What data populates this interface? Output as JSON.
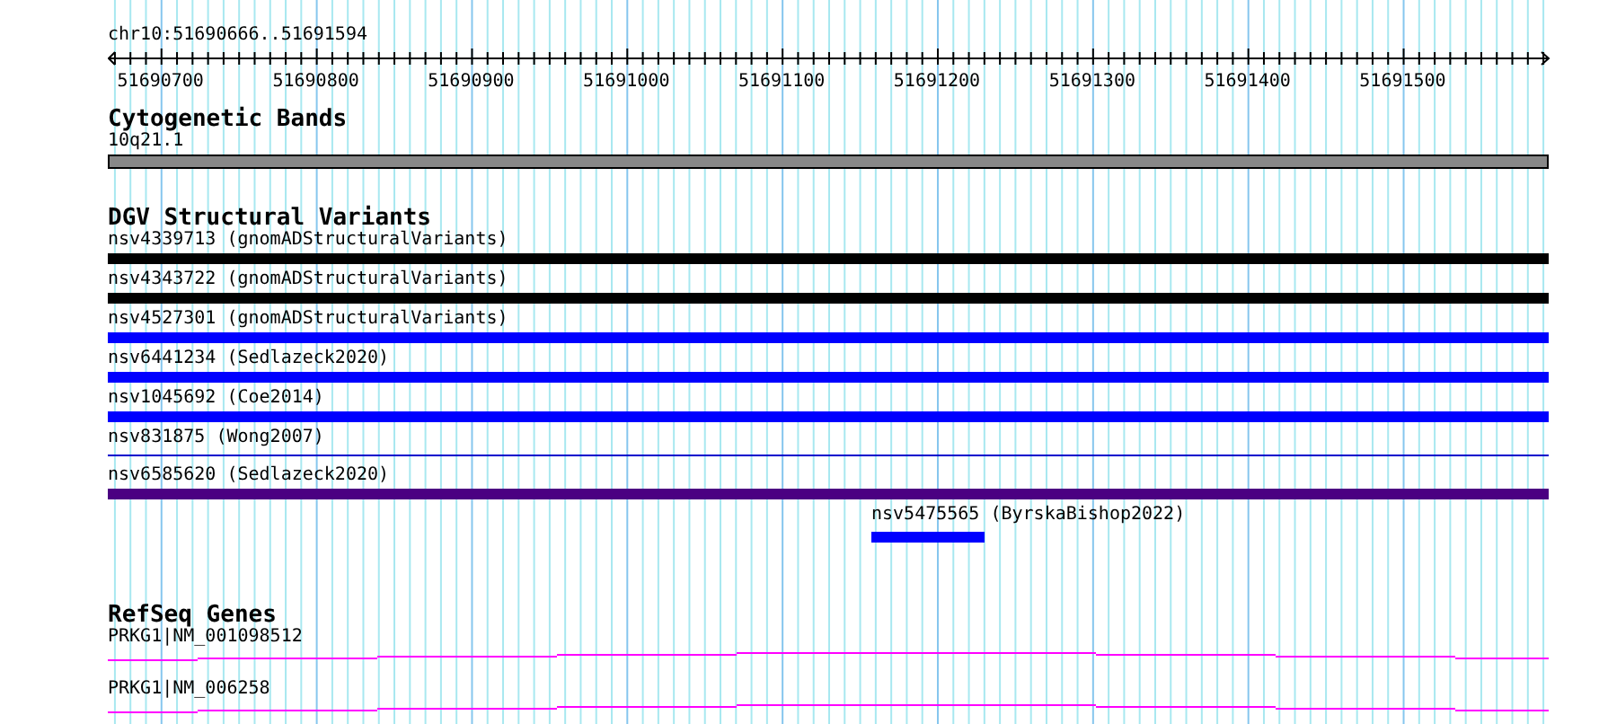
{
  "ruler": {
    "location": "chr10:51690666..51691594",
    "tick_labels": [
      "51690700",
      "51690800",
      "51690900",
      "51691000",
      "51691100",
      "51691200",
      "51691300",
      "51691400",
      "51691500"
    ]
  },
  "cytogenetic_bands": {
    "title": "Cytogenetic Bands",
    "band_label": "10q21.1"
  },
  "dgv_structural_variants": {
    "title": "DGV Structural Variants",
    "features": [
      {
        "label": "nsv4339713 (gnomADStructuralVariants)",
        "kind": "bar",
        "color": "#000000"
      },
      {
        "label": "nsv4343722 (gnomADStructuralVariants)",
        "kind": "bar",
        "color": "#000000"
      },
      {
        "label": "nsv4527301 (gnomADStructuralVariants)",
        "kind": "bar",
        "color": "#0000ff"
      },
      {
        "label": "nsv6441234 (Sedlazeck2020)",
        "kind": "bar",
        "color": "#0000ff"
      },
      {
        "label": "nsv1045692 (Coe2014)",
        "kind": "bar",
        "color": "#0000ff"
      },
      {
        "label": "nsv831875 (Wong2007)",
        "kind": "line",
        "color": "#0000cc"
      },
      {
        "label": "nsv6585620 (Sedlazeck2020)",
        "kind": "bar",
        "color": "#4b0082"
      },
      {
        "label": "nsv5475565 (ByrskaBishop2022)",
        "kind": "short-bar",
        "color": "#0000ff"
      }
    ]
  },
  "refseq_genes": {
    "title": "RefSeq Genes",
    "genes": [
      {
        "label": "PRKG1|NM_001098512"
      },
      {
        "label": "PRKG1|NM_006258"
      }
    ]
  }
}
